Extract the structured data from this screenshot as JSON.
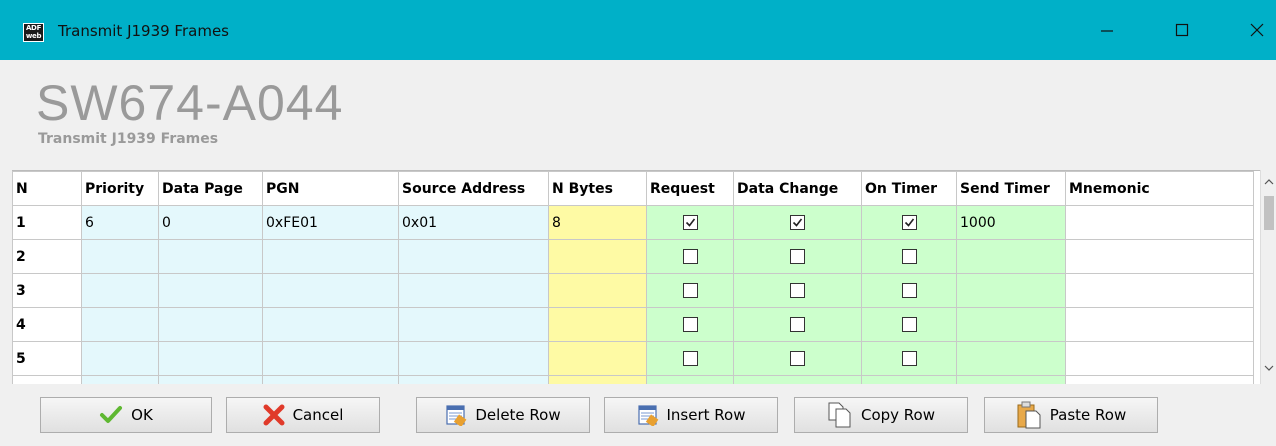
{
  "window": {
    "title": "Transmit J1939 Frames",
    "app_icon_text_top": "ADF",
    "app_icon_text_bottom": "web"
  },
  "header": {
    "title": "SW674-A044",
    "subtitle": "Transmit J1939 Frames"
  },
  "grid": {
    "columns": [
      "N",
      "Priority",
      "Data Page",
      "PGN",
      "Source Address",
      "N Bytes",
      "Request",
      "Data Change",
      "On Timer",
      "Send Timer",
      "Mnemonic"
    ],
    "rows": [
      {
        "n": "1",
        "priority": "6",
        "data_page": "0",
        "pgn": "0xFE01",
        "source_address": "0x01",
        "n_bytes": "8",
        "request": true,
        "data_change": true,
        "on_timer": true,
        "send_timer": "1000",
        "mnemonic": ""
      },
      {
        "n": "2",
        "priority": "",
        "data_page": "",
        "pgn": "",
        "source_address": "",
        "n_bytes": "",
        "request": false,
        "data_change": false,
        "on_timer": false,
        "send_timer": "",
        "mnemonic": ""
      },
      {
        "n": "3",
        "priority": "",
        "data_page": "",
        "pgn": "",
        "source_address": "",
        "n_bytes": "",
        "request": false,
        "data_change": false,
        "on_timer": false,
        "send_timer": "",
        "mnemonic": ""
      },
      {
        "n": "4",
        "priority": "",
        "data_page": "",
        "pgn": "",
        "source_address": "",
        "n_bytes": "",
        "request": false,
        "data_change": false,
        "on_timer": false,
        "send_timer": "",
        "mnemonic": ""
      },
      {
        "n": "5",
        "priority": "",
        "data_page": "",
        "pgn": "",
        "source_address": "",
        "n_bytes": "",
        "request": false,
        "data_change": false,
        "on_timer": false,
        "send_timer": "",
        "mnemonic": ""
      },
      {
        "n": "",
        "priority": "",
        "data_page": "",
        "pgn": "",
        "source_address": "",
        "n_bytes": "",
        "request": false,
        "data_change": false,
        "on_timer": false,
        "send_timer": "",
        "mnemonic": ""
      }
    ]
  },
  "buttons": {
    "ok": "OK",
    "cancel": "Cancel",
    "delete_row": "Delete Row",
    "insert_row": "Insert Row",
    "copy_row": "Copy Row",
    "paste_row": "Paste Row"
  },
  "colors": {
    "titlebar": "#00b0c8",
    "blue_cells": "#e4f8fc",
    "yellow_cells": "#fefaa4",
    "green_cells": "#ccffcc"
  },
  "icons": [
    "minimize-icon",
    "maximize-icon",
    "close-icon",
    "checkmark-icon",
    "cross-icon",
    "delete-row-icon",
    "insert-row-icon",
    "copy-icon",
    "paste-icon"
  ]
}
